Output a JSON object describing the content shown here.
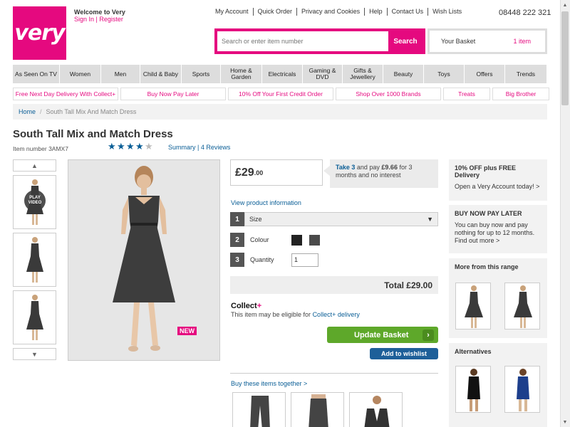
{
  "brand": {
    "logo_text": "very",
    "color": "#e5097f"
  },
  "header": {
    "welcome": "Welcome to Very",
    "sign_in": "Sign In",
    "register": "Register",
    "links": [
      "My Account",
      "Quick Order",
      "Privacy and Cookies",
      "Help",
      "Contact Us",
      "Wish Lists"
    ],
    "phone": "08448 222 321"
  },
  "search": {
    "placeholder": "Search or enter item number",
    "button": "Search"
  },
  "basket": {
    "label": "Your Basket",
    "count": "1 item"
  },
  "nav": [
    {
      "label": "As Seen On TV",
      "w": 66
    },
    {
      "label": "Women",
      "w": 58
    },
    {
      "label": "Men",
      "w": 55
    },
    {
      "label": "Child & Baby",
      "w": 58
    },
    {
      "label": "Sports",
      "w": 55
    },
    {
      "label": "Home & Garden",
      "w": 58
    },
    {
      "label": "Electricals",
      "w": 57
    },
    {
      "label": "Gaming & DVD",
      "w": 56
    },
    {
      "label": "Gifts & Jewellery",
      "w": 57
    },
    {
      "label": "Beauty",
      "w": 57
    },
    {
      "label": "Toys",
      "w": 57
    },
    {
      "label": "Offers",
      "w": 57
    },
    {
      "label": "Trends",
      "w": 59
    }
  ],
  "promos": [
    {
      "label": "Free Next Day Delivery With Collect+",
      "w": 148
    },
    {
      "label": "Buy Now Pay Later",
      "w": 148
    },
    {
      "label": "10% Off Your First Credit Order",
      "w": 148
    },
    {
      "label": "Shop Over 1000 Brands",
      "w": 148
    },
    {
      "label": "Treats",
      "w": 66
    },
    {
      "label": "Big Brother",
      "w": 80
    }
  ],
  "breadcrumb": {
    "home": "Home",
    "separator": "/",
    "current": "South Tall Mix And Match Dress"
  },
  "product": {
    "title": "South Tall Mix and Match Dress",
    "item_number": "Item number 3AMX7",
    "rating": 4,
    "rating_max": 5,
    "summary": "Summary",
    "reviews": "4 Reviews",
    "price_main": "£29",
    "price_pence": ".00",
    "finance_take": "Take 3",
    "finance_text": "and pay",
    "finance_amount": "£9.66",
    "finance_rest": "for 3 months and no interest",
    "view_info": "View product information",
    "options": {
      "size_label": "Size",
      "colour_label": "Colour",
      "quantity_label": "Quantity",
      "quantity_value": "1",
      "colours": [
        "#222222",
        "#4a4a4a"
      ]
    },
    "total": "Total £29.00",
    "collect_brand": "Collect",
    "collect_plus": "+",
    "collect_text": "This item may be eligible for",
    "collect_link": "Collect+ delivery",
    "update_button": "Update Basket",
    "wishlist_button": "Add to wishlist",
    "new_badge": "NEW",
    "play_video": "PLAY VIDEO",
    "buy_together": "Buy these items together >"
  },
  "side": {
    "offer_title": "10% OFF plus FREE Delivery",
    "offer_text": "Open a Very Account today! >",
    "bnpl_title": "BUY NOW PAY LATER",
    "bnpl_text": "You can buy now and pay nothing for up to 12 months. Find out more >",
    "range_title": "More from this range",
    "alt_title": "Alternatives"
  },
  "numbers": [
    "1",
    "2",
    "3"
  ]
}
